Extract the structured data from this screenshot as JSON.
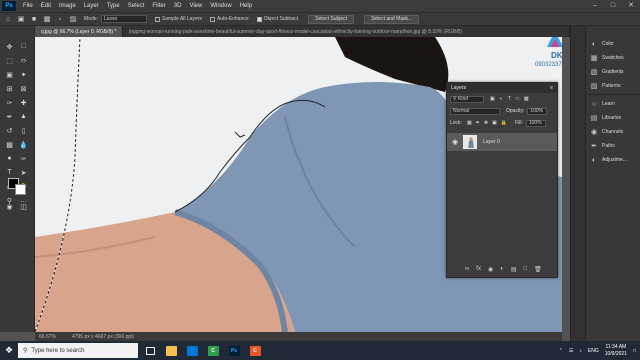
{
  "menubar": {
    "app_icon": "Ps",
    "items": [
      "File",
      "Edit",
      "Image",
      "Layer",
      "Type",
      "Select",
      "Filter",
      "3D",
      "View",
      "Window",
      "Help"
    ]
  },
  "options_bar": {
    "mode_label": "Mode:",
    "mode_value": "Lasso",
    "sample_all_layers": "Sample All Layers",
    "sample_all_layers_checked": false,
    "auto_enhance": "Auto-Enhance",
    "auto_enhance_checked": false,
    "object_subtract": "Object Subtract",
    "object_subtract_checked": true,
    "select_subject": "Select Subject",
    "select_and_mask": "Select and Mask..."
  },
  "tabs": [
    {
      "label": "q.jpg @ 66.7% (Layer 0, RGB/8) *",
      "active": true
    },
    {
      "label": "jogging-woman-running-park-sunshine-beautiful-summer-day-sport-fitness-model-caucasian-ethnicity-training-outdoor-marathon.jpg @ 8.33% (RGB/8)",
      "active": false
    }
  ],
  "statusbar": {
    "zoom": "66.67%",
    "doc_size": "4795 px x 4667 px (300 ppi)"
  },
  "watermark": {
    "text_top": "DK",
    "text_phone": "0903233733"
  },
  "layers_panel": {
    "title": "Layers",
    "filter_label": "Kind",
    "blend_mode": "Normal",
    "opacity_label": "Opacity:",
    "opacity_value": "100%",
    "lock_label": "Lock:",
    "fill_label": "Fill:",
    "fill_value": "100%",
    "layer_name": "Layer 0"
  },
  "right_panel": {
    "group1": [
      "Color",
      "Swatches",
      "Gradients",
      "Patterns"
    ],
    "group2": [
      "Learn",
      "Libraries",
      "Channels",
      "Paths",
      "Adjustme..."
    ]
  },
  "taskbar": {
    "search_placeholder": "Type here to search",
    "lang": "ENG",
    "time": "11:34 AM",
    "date": "10/9/2021"
  },
  "colors": {
    "accent": "#31a8ff",
    "shirt": "#7f97b4",
    "canvas_bg": "#eef0f2",
    "panel": "#383838"
  }
}
